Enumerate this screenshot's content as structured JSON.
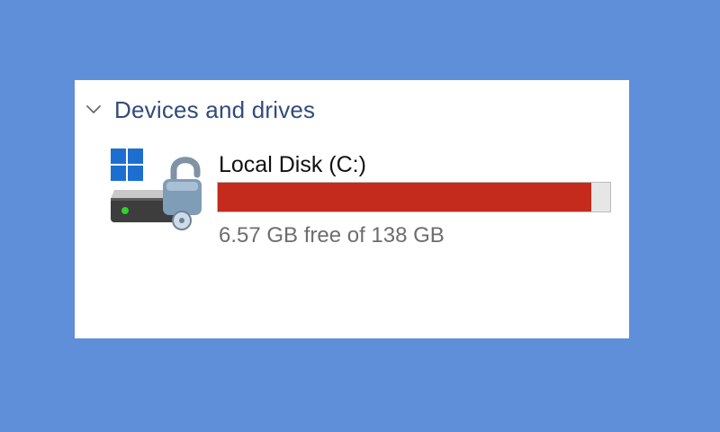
{
  "group": {
    "title": "Devices and drives",
    "expanded": true,
    "chevron_icon": "chevron-down-icon"
  },
  "drives": [
    {
      "name": "Local Disk (C:)",
      "free_text": "6.57 GB free of 138 GB",
      "free_gb": 6.57,
      "total_gb": 138,
      "used_fraction": 0.952,
      "bar_color": "#c42b1c",
      "bar_track_color": "#e6e6e6",
      "icon": "windows-drive-unlocked-icon"
    }
  ],
  "colors": {
    "background": "#5f8fd9",
    "panel": "#ffffff",
    "group_title": "#324b7a",
    "secondary_text": "#6d6d6d"
  }
}
